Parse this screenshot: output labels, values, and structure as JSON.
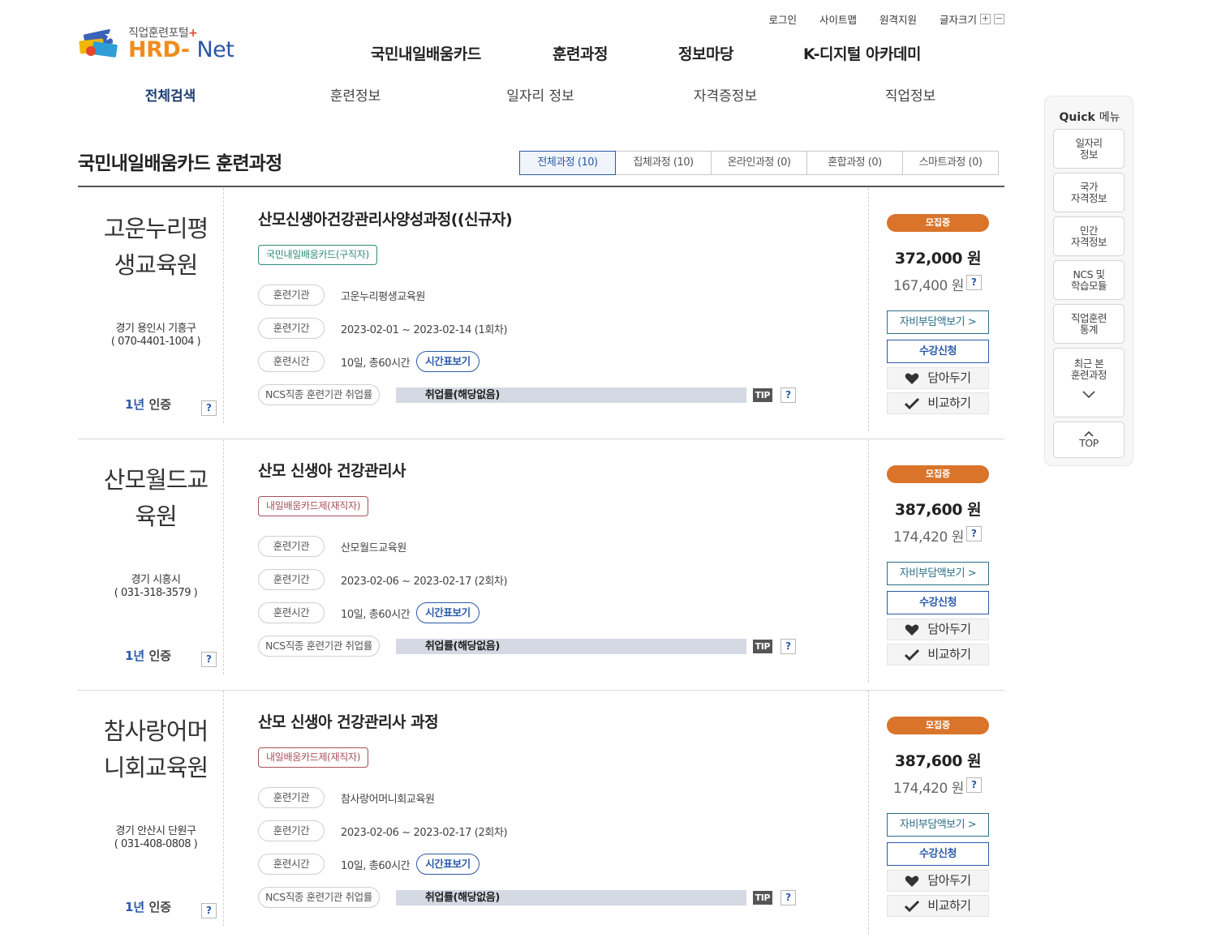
{
  "logo": {
    "sub": "직업훈련포털",
    "plus": "+",
    "main": "HRD",
    "dash": "-",
    "net": "Net"
  },
  "util": {
    "login": "로그인",
    "sitemap": "사이트맵",
    "remote": "원격지원",
    "font_size": "글자크기",
    "plus": "+",
    "minus": "−"
  },
  "gnb": [
    "국민내일배움카드",
    "훈련과정",
    "정보마당",
    "K-디지털 아카데미"
  ],
  "snb": [
    "전체검색",
    "훈련정보",
    "일자리 정보",
    "자격증정보",
    "직업정보"
  ],
  "page_title": "국민내일배움카드 훈련과정",
  "tabs": [
    "전체과정 (10)",
    "집체과정 (10)",
    "온라인과정 (0)",
    "혼합과정 (0)",
    "스마트과정 (0)"
  ],
  "labels": {
    "institution": "훈련기관",
    "period": "훈련기간",
    "hours": "훈련시간",
    "timetable": "시간표보기",
    "ncs": "NCS직종 훈련기관 취업률",
    "tip": "TIP",
    "question": "?",
    "cert_num": "1년",
    "cert_text": "인증",
    "recruiting": "모집중",
    "self_pay": "자비부담액보기 >",
    "apply": "수강신청",
    "wish": "담아두기",
    "compare": "비교하기"
  },
  "courses": [
    {
      "inst_line1": "고운누리평",
      "inst_line2": "생교육원",
      "location": "경기 용인시 기흥구",
      "phone": "( 070-4401-1004 )",
      "title": "산모신생아건강관리사양성과정((신규자)",
      "tag": "국민내일배움카드(구직자)",
      "institution": "고운누리평생교육원",
      "period": "2023-02-01 ~ 2023-02-14 (1회차)",
      "hours": "10일, 총60시간",
      "employment": "취업률(해당없음)",
      "price": "372,000 원",
      "self_price": "167,400 원"
    },
    {
      "inst_line1": "산모월드교",
      "inst_line2": "육원",
      "location": "경기 시흥시",
      "phone": "( 031-318-3579 )",
      "title": "산모 신생아 건강관리사",
      "tag": "내일배움카드제(재직자)",
      "institution": "산모월드교육원",
      "period": "2023-02-06 ~ 2023-02-17 (2회차)",
      "hours": "10일, 총60시간",
      "employment": "취업률(해당없음)",
      "price": "387,600 원",
      "self_price": "174,420 원"
    },
    {
      "inst_line1": "참사랑어머",
      "inst_line2": "니회교육원",
      "location": "경기 안산시 단원구",
      "phone": "( 031-408-0808 )",
      "title": "산모 신생아 건강관리사 과정",
      "tag": "내일배움카드제(재직자)",
      "institution": "참사랑어머니회교육원",
      "period": "2023-02-06 ~ 2023-02-17 (2회차)",
      "hours": "10일, 총60시간",
      "employment": "취업률(해당없음)",
      "price": "387,600 원",
      "self_price": "174,420 원"
    }
  ],
  "quick": {
    "title_en": "Quick",
    "title_ko": "메뉴",
    "items": [
      {
        "l1": "일자리",
        "l2": "정보"
      },
      {
        "l1": "국가",
        "l2": "자격정보"
      },
      {
        "l1": "민간",
        "l2": "자격정보"
      },
      {
        "l1": "NCS 및",
        "l2": "학습모듈"
      },
      {
        "l1": "직업훈련",
        "l2": "통계"
      },
      {
        "l1": "최근 본",
        "l2": "훈련과정"
      }
    ],
    "top_label": "TOP"
  }
}
